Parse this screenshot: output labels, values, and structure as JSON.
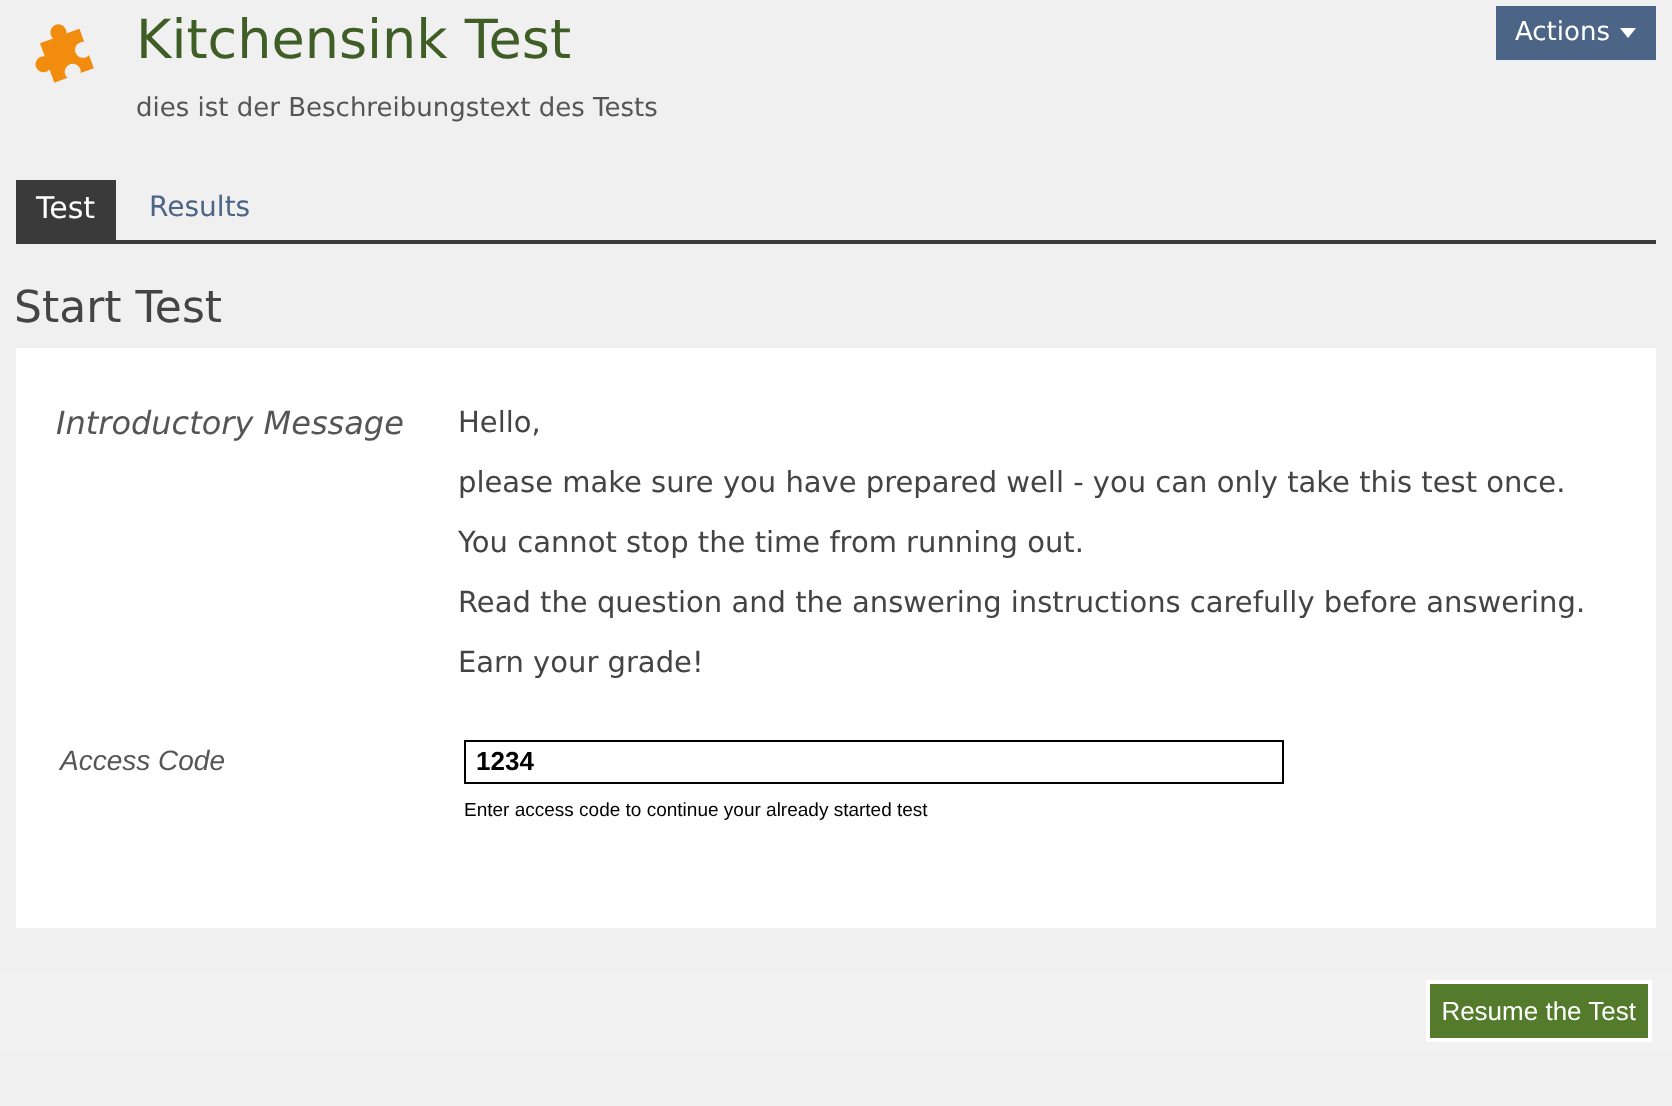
{
  "header": {
    "title": "Kitchensink Test",
    "description": "dies ist der Beschreibungstext des Tests",
    "actions_button": "Actions"
  },
  "tabs": [
    {
      "label": "Test",
      "selected": true
    },
    {
      "label": "Results",
      "selected": false
    }
  ],
  "section_title": "Start Test",
  "form": {
    "intro_label": "Introductory Message",
    "intro_lines": [
      "Hello,",
      "please make sure you have prepared well - you can only take this test once.",
      "You cannot stop the time from running out.",
      "Read the question and the answering instructions carefully before answering.",
      "Earn your grade!"
    ],
    "access_code": {
      "label": "Access Code",
      "value": "1234",
      "help": "Enter access code to continue your already started test"
    }
  },
  "resume_button": "Resume the Test"
}
